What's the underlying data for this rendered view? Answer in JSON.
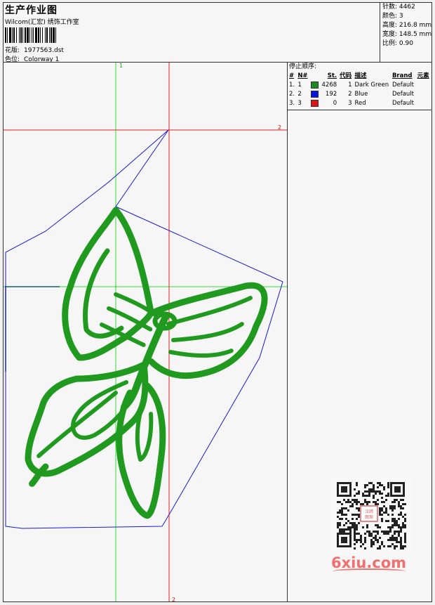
{
  "header": {
    "title": "生产作业图",
    "company": "Wilcom(汇宏) 绣饰工作室",
    "design_file_label": "花版:",
    "design_file": "1977563.dst",
    "colorway_label": "色位:",
    "colorway": "Colorway 1"
  },
  "stats": [
    {
      "label": "针数:",
      "value": "4462"
    },
    {
      "label": "颜色:",
      "value": "3"
    },
    {
      "label": "高度:",
      "value": "216.8 mm"
    },
    {
      "label": "宽度:",
      "value": "148.5 mm"
    },
    {
      "label": "比例:",
      "value": "0.90"
    }
  ],
  "stop_sequence": {
    "title": "停止顺序:",
    "columns": [
      "#",
      "N#",
      "St.",
      "代码",
      "描述",
      "Brand",
      "元素"
    ],
    "rows": [
      {
        "num": "1.",
        "n": "1",
        "color": "#1a8c1a",
        "st": "4268",
        "code": "1",
        "desc": "Dark Green",
        "brand": "Default"
      },
      {
        "num": "2.",
        "n": "2",
        "color": "#0a14d8",
        "st": "192",
        "code": "2",
        "desc": "Blue",
        "brand": "Default"
      },
      {
        "num": "3.",
        "n": "3",
        "color": "#e01414",
        "st": "0",
        "code": "3",
        "desc": "Red",
        "brand": "Default"
      }
    ]
  },
  "design": {
    "marker_top": "1",
    "marker_right": "2",
    "marker_bottom": "2",
    "thread_color": "#1f9a1f",
    "outline_color": "#1a1ad0",
    "axis_green": "#35d835",
    "axis_red": "#e02020"
  },
  "watermark": "6xiu.com"
}
